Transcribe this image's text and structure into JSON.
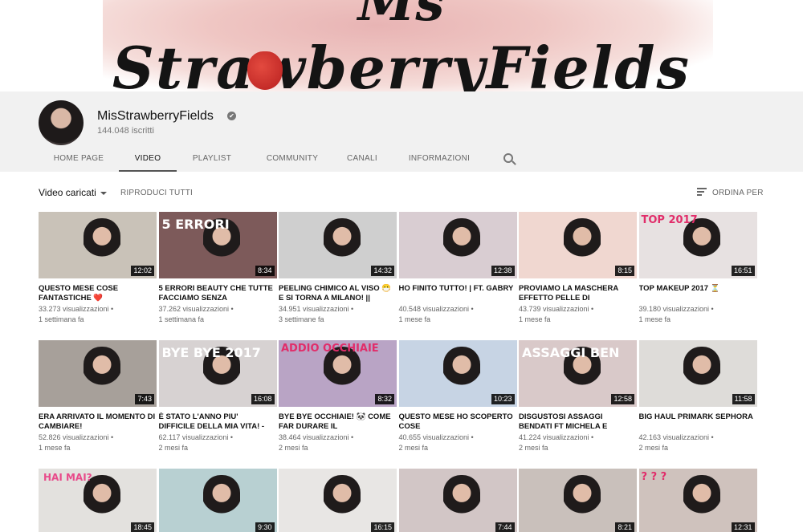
{
  "banner": {
    "top_text": "Ms",
    "main_text": "StrawberryFields"
  },
  "channel": {
    "name": "MisStrawberryFields",
    "verified": "✔",
    "subscribers": "144.048 iscritti"
  },
  "tabs": [
    "HOME PAGE",
    "VIDEO",
    "PLAYLIST",
    "COMMUNITY",
    "CANALI",
    "INFORMAZIONI"
  ],
  "active_tab": "VIDEO",
  "toolbar": {
    "uploads_label": "Video caricati",
    "play_all": "RIPRODUCI TUTTI",
    "sort_label": "ORDINA PER"
  },
  "videos": [
    {
      "title": "QUESTO MESE COSE FANTASTICHE ❤️",
      "views": "33.273 visualizzazioni",
      "age": "1 settimana fa",
      "duration": "12:02",
      "bg": "#c9c2b8"
    },
    {
      "title": "5 ERRORI BEAUTY CHE TUTTE FACCIAMO SENZA",
      "views": "37.262 visualizzazioni",
      "age": "1 settimana fa",
      "duration": "8:34",
      "bg": "#7d5a5a",
      "overlay": "5\nERRORI"
    },
    {
      "title": "PEELING CHIMICO AL VISO 😷 E SI TORNA A MILANO! ||",
      "views": "34.951 visualizzazioni",
      "age": "3 settimane fa",
      "duration": "14:32",
      "bg": "#cfcfcf"
    },
    {
      "title": "HO FINITO TUTTO! | ft. Gabry",
      "views": "40.548 visualizzazioni",
      "age": "1 mese fa",
      "duration": "12:38",
      "bg": "#d9cdd2"
    },
    {
      "title": "PROVIAMO LA MASCHERA EFFETTO PELLE DI",
      "views": "43.739 visualizzazioni",
      "age": "1 mese fa",
      "duration": "8:15",
      "bg": "#f0d7d0"
    },
    {
      "title": "TOP MAKEUP 2017 ⏳",
      "views": "39.180 visualizzazioni",
      "age": "1 mese fa",
      "duration": "16:51",
      "bg": "#e7e1e1",
      "overlay": "TOP 2017"
    },
    {
      "title": "ERA ARRIVATO IL MOMENTO DI CAMBIARE!",
      "views": "52.826 visualizzazioni",
      "age": "1 mese fa",
      "duration": "7:43",
      "bg": "#a7a09a"
    },
    {
      "title": "È STATO L'ANNO PIU' DIFFICILE DELLA MIA VITA! -",
      "views": "62.117 visualizzazioni",
      "age": "2 mesi fa",
      "duration": "16:08",
      "bg": "#d7d2d2",
      "overlay": "BYE BYE 2017"
    },
    {
      "title": "BYE BYE OCCHIAIE! 🐼 COME FAR DURARE IL",
      "views": "38.464 visualizzazioni",
      "age": "2 mesi fa",
      "duration": "8:32",
      "bg": "#b9a4c5",
      "overlay": "ADDIO OCCHIAIE"
    },
    {
      "title": "QUESTO MESE HO SCOPERTO COSE",
      "views": "40.655 visualizzazioni",
      "age": "2 mesi fa",
      "duration": "10:23",
      "bg": "#c7d4e4"
    },
    {
      "title": "DISGUSTOSI ASSAGGI BENDATI ft MICHELA e",
      "views": "41.224 visualizzazioni",
      "age": "2 mesi fa",
      "duration": "12:58",
      "bg": "#d9c9c9",
      "overlay": "ASSAGGI BEN"
    },
    {
      "title": "BIG HAUL PRIMARK SEPHORA",
      "views": "42.163 visualizzazioni",
      "age": "2 mesi fa",
      "duration": "11:58",
      "bg": "#dedcd9"
    },
    {
      "title": "",
      "views": "",
      "age": "",
      "duration": "18:45",
      "bg": "#e3e1de",
      "overlay": "HAI MAI?"
    },
    {
      "title": "",
      "views": "",
      "age": "",
      "duration": "9:30",
      "bg": "#b8d0d2"
    },
    {
      "title": "",
      "views": "",
      "age": "",
      "duration": "16:15",
      "bg": "#e8e6e4"
    },
    {
      "title": "",
      "views": "",
      "age": "",
      "duration": "7:44",
      "bg": "#d2c6c6"
    },
    {
      "title": "",
      "views": "",
      "age": "",
      "duration": "8:21",
      "bg": "#c9c0bb"
    },
    {
      "title": "",
      "views": "",
      "age": "",
      "duration": "12:31",
      "bg": "#cfc2bd",
      "overlay": "? ? ?"
    }
  ]
}
